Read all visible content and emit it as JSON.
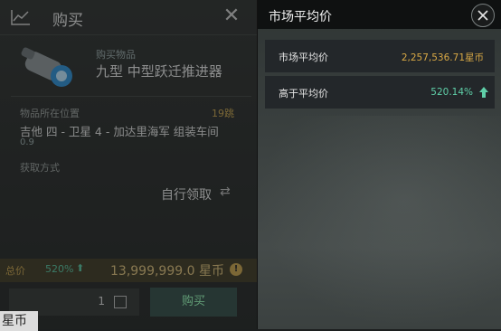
{
  "buy_panel": {
    "title": "购买",
    "item_label": "购买物品",
    "item_name": "九型 中型跃迁推进器",
    "location_label": "物品所在位置",
    "jumps": "19跳",
    "location_value": "吉他 四 - 卫星 4 - 加达里海军 组装车间",
    "security": "0.9",
    "acquire_label": "获取方式",
    "acquire_value": "自行领取",
    "total_label": "总价",
    "total_pct": "520%",
    "total_value": "13,999,999.0 星币",
    "quantity": "1",
    "buy_button": "购买",
    "corner_text": "星币"
  },
  "market_panel": {
    "title": "市场平均价",
    "rows": [
      {
        "label": "市场平均价",
        "value": "2,257,536.71星币"
      },
      {
        "label": "高于平均价",
        "value": "520.14%"
      }
    ]
  },
  "colors": {
    "gold": "#d9a945",
    "green": "#5fcfa8",
    "header_bg": "#0f1111",
    "row_bg": "#23272a"
  }
}
